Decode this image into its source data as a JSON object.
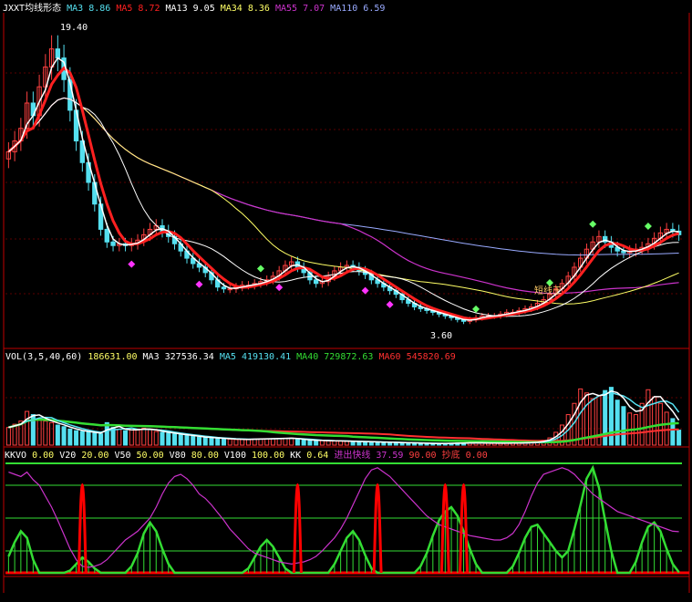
{
  "colors": {
    "background": "#000000",
    "panel_border": "#c00000",
    "grid": "#5a0000",
    "up": "#ff4040",
    "down": "#55e0f0",
    "ma3": "#ffffff",
    "ma5": "#ff2020",
    "ma13": "#ffffff",
    "ma34": "#ffff66",
    "ma55": "#cc33cc",
    "ma110": "#99aaff",
    "buy_marker": "#66ff66",
    "sell_marker": "#ff33ff",
    "green": "#33dd33",
    "magenta": "#cc33cc",
    "red": "#ff0000"
  },
  "main_legend": [
    {
      "text": "JXXT均线形态",
      "color": "#ffffff"
    },
    {
      "text": "MA3",
      "color": "#55e0f0"
    },
    {
      "text": "8.86",
      "color": "#55e0f0"
    },
    {
      "text": "MA5",
      "color": "#ff2020"
    },
    {
      "text": "8.72",
      "color": "#ff2020"
    },
    {
      "text": "MA13",
      "color": "#ffffff"
    },
    {
      "text": "9.05",
      "color": "#ffffff"
    },
    {
      "text": "MA34",
      "color": "#ffff66"
    },
    {
      "text": "8.36",
      "color": "#ffff66"
    },
    {
      "text": "MA55",
      "color": "#cc33cc"
    },
    {
      "text": "7.07",
      "color": "#cc33cc"
    },
    {
      "text": "MA110",
      "color": "#99aaff"
    },
    {
      "text": "6.59",
      "color": "#99aaff"
    }
  ],
  "vol_legend": [
    {
      "text": "VOL(3,5,40,60)",
      "color": "#ffffff"
    },
    {
      "text": "186631.00",
      "color": "#ffff66"
    },
    {
      "text": "MA3",
      "color": "#ffffff"
    },
    {
      "text": "327536.34",
      "color": "#ffffff"
    },
    {
      "text": "MA5",
      "color": "#55e0f0"
    },
    {
      "text": "419130.41",
      "color": "#55e0f0"
    },
    {
      "text": "MA40",
      "color": "#33dd33"
    },
    {
      "text": "729872.63",
      "color": "#33dd33"
    },
    {
      "text": "MA60",
      "color": "#ff3030"
    },
    {
      "text": "545820.69",
      "color": "#ff3030"
    }
  ],
  "kk_legend": [
    {
      "text": "KKVO",
      "color": "#ffffff"
    },
    {
      "text": "0.00",
      "color": "#ffff66"
    },
    {
      "text": "V20",
      "color": "#ffffff"
    },
    {
      "text": "20.00",
      "color": "#ffff66"
    },
    {
      "text": "V50",
      "color": "#ffffff"
    },
    {
      "text": "50.00",
      "color": "#ffff66"
    },
    {
      "text": "V80",
      "color": "#ffffff"
    },
    {
      "text": "80.00",
      "color": "#ffff66"
    },
    {
      "text": "V100",
      "color": "#ffffff"
    },
    {
      "text": "100.00",
      "color": "#ffff66"
    },
    {
      "text": "KK",
      "color": "#ffffff"
    },
    {
      "text": "0.64",
      "color": "#ffff66"
    },
    {
      "text": "进出快线",
      "color": "#cc33cc"
    },
    {
      "text": "37.59",
      "color": "#cc33cc"
    },
    {
      "text": "90.00",
      "color": "#ff4040"
    },
    {
      "text": "抄底",
      "color": "#ff4040"
    },
    {
      "text": "0.00",
      "color": "#ff4040"
    }
  ],
  "annotations": {
    "high_label": "19.40",
    "low_label": "3.60",
    "signal_label": "短线王"
  },
  "chart_data": [
    {
      "type": "candlestick",
      "panel": "price",
      "title": "JXXT均线形态",
      "ylim": [
        2.5,
        20.5
      ],
      "highest": 19.4,
      "lowest": 3.6,
      "close": [
        13.2,
        13.8,
        14.5,
        15.9,
        15.2,
        16.8,
        17.9,
        18.9,
        18.4,
        17.2,
        15.5,
        13.8,
        12.6,
        11.5,
        10.3,
        8.9,
        8.2,
        8.0,
        8.1,
        8.0,
        8.1,
        8.3,
        8.6,
        8.9,
        9.1,
        8.8,
        8.5,
        8.1,
        7.7,
        7.3,
        7.0,
        6.8,
        6.5,
        6.1,
        5.7,
        5.6,
        5.6,
        5.7,
        5.8,
        5.8,
        5.9,
        6.0,
        6.1,
        6.3,
        6.6,
        6.9,
        7.1,
        6.8,
        6.5,
        6.1,
        5.9,
        6.0,
        6.3,
        6.6,
        6.8,
        6.9,
        6.8,
        6.6,
        6.4,
        6.1,
        5.9,
        5.7,
        5.5,
        5.3,
        5.0,
        4.8,
        4.6,
        4.5,
        4.4,
        4.3,
        4.2,
        4.1,
        4.0,
        3.9,
        3.8,
        3.9,
        4.0,
        4.1,
        4.1,
        4.1,
        4.2,
        4.3,
        4.3,
        4.4,
        4.5,
        4.6,
        4.8,
        5.0,
        5.3,
        5.6,
        5.9,
        6.3,
        6.8,
        7.3,
        7.8,
        8.2,
        8.5,
        8.2,
        7.9,
        7.7,
        7.6,
        7.7,
        7.8,
        7.9,
        8.1,
        8.4,
        8.7,
        8.9,
        8.8,
        8.6
      ],
      "ma_latest": {
        "MA3": 8.86,
        "MA5": 8.72,
        "MA13": 9.05,
        "MA34": 8.36,
        "MA55": 7.07,
        "MA110": 6.59
      }
    },
    {
      "type": "bar",
      "panel": "volume",
      "title": "VOL(3,5,40,60)",
      "ylim": [
        0,
        1000000
      ],
      "values": [
        220000,
        260000,
        300000,
        420000,
        380000,
        330000,
        300000,
        280000,
        250000,
        230000,
        200000,
        180000,
        170000,
        160000,
        150000,
        140000,
        280000,
        220000,
        200000,
        180000,
        190000,
        200000,
        210000,
        190000,
        170000,
        160000,
        150000,
        140000,
        130000,
        120000,
        110000,
        100000,
        95000,
        90000,
        85000,
        80000,
        75000,
        70000,
        72000,
        74000,
        76000,
        78000,
        80000,
        82000,
        84000,
        86000,
        88000,
        70000,
        65000,
        60000,
        58000,
        56000,
        54000,
        52000,
        50000,
        48000,
        46000,
        44000,
        42000,
        40000,
        38000,
        36000,
        34000,
        32000,
        30000,
        28000,
        26000,
        24000,
        22000,
        20000,
        20000,
        22000,
        24000,
        26000,
        28000,
        30000,
        28000,
        26000,
        25000,
        24000,
        24000,
        25000,
        26000,
        28000,
        30000,
        35000,
        40000,
        60000,
        90000,
        160000,
        250000,
        380000,
        520000,
        700000,
        650000,
        580000,
        620000,
        680000,
        720000,
        560000,
        480000,
        400000,
        380000,
        520000,
        690000,
        600000,
        520000,
        410000,
        330000,
        186631
      ],
      "ma_latest": {
        "MA3": 327536.34,
        "MA5": 419130.41,
        "MA40": 729872.63,
        "MA60": 545820.69
      }
    },
    {
      "type": "line",
      "panel": "indicator",
      "title": "KKVO",
      "ylim": [
        0,
        100
      ],
      "levels": {
        "V20": 20.0,
        "V50": 50.0,
        "V80": 80.0,
        "V100": 100.0
      },
      "latest": {
        "KKVO": 0.0,
        "KK": 0.64,
        "进出快线": 37.59,
        "抄底": 0.0
      },
      "series": [
        {
          "name": "进出快线",
          "values": [
            92,
            90,
            88,
            92,
            85,
            80,
            70,
            60,
            48,
            35,
            22,
            12,
            6,
            5,
            6,
            8,
            12,
            18,
            24,
            30,
            34,
            38,
            44,
            50,
            60,
            72,
            82,
            88,
            90,
            86,
            80,
            72,
            68,
            62,
            55,
            48,
            40,
            34,
            28,
            22,
            18,
            16,
            14,
            12,
            10,
            9,
            8,
            9,
            10,
            12,
            15,
            20,
            26,
            32,
            40,
            50,
            62,
            74,
            86,
            94,
            96,
            92,
            88,
            82,
            76,
            70,
            64,
            58,
            52,
            48,
            44,
            42,
            40,
            38,
            36,
            34,
            33,
            32,
            31,
            30,
            30,
            32,
            36,
            44,
            56,
            70,
            82,
            90,
            92,
            94,
            96,
            94,
            90,
            84,
            78,
            72,
            68,
            64,
            60,
            56,
            54,
            52,
            50,
            48,
            46,
            44,
            42,
            40,
            38,
            37.59
          ]
        },
        {
          "name": "KK",
          "values": [
            15,
            28,
            38,
            32,
            12,
            0,
            0,
            0,
            0,
            0,
            2,
            8,
            14,
            10,
            4,
            0,
            0,
            0,
            0,
            0,
            6,
            18,
            36,
            46,
            38,
            22,
            8,
            0,
            0,
            0,
            0,
            0,
            0,
            0,
            0,
            0,
            0,
            0,
            0,
            4,
            14,
            24,
            30,
            24,
            14,
            4,
            0,
            0,
            0,
            0,
            0,
            0,
            0,
            8,
            20,
            32,
            38,
            30,
            16,
            4,
            0,
            0,
            0,
            0,
            0,
            0,
            0,
            6,
            18,
            34,
            48,
            56,
            60,
            52,
            38,
            22,
            8,
            0,
            0,
            0,
            0,
            0,
            6,
            18,
            32,
            42,
            44,
            36,
            28,
            20,
            14,
            20,
            40,
            62,
            86,
            96,
            78,
            48,
            20,
            0,
            0,
            0,
            10,
            28,
            42,
            46,
            38,
            22,
            8,
            0.64
          ]
        }
      ],
      "markers": {
        "抄底": [
          12,
          47,
          60,
          71,
          74
        ]
      }
    }
  ]
}
